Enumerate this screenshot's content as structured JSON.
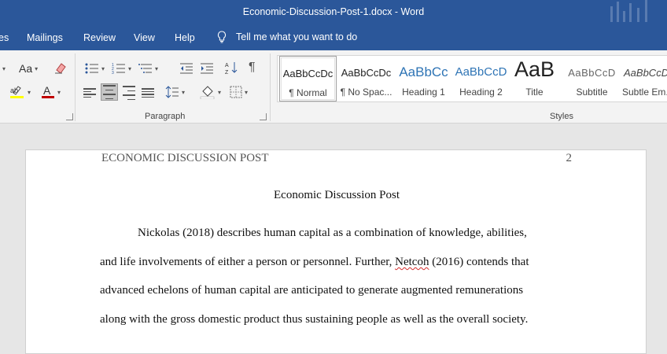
{
  "window": {
    "title": "Economic-Discussion-Post-1.docx  -  Word"
  },
  "tabs": {
    "partial": "es",
    "mailings": "Mailings",
    "review": "Review",
    "view": "View",
    "help": "Help"
  },
  "tell_me": {
    "text": "Tell me what you want to do"
  },
  "ribbon": {
    "font": {
      "change_case": "Aa"
    },
    "paragraph": {
      "label": "Paragraph"
    },
    "styles": {
      "label": "Styles",
      "items": [
        {
          "sample": "AaBbCcDc",
          "name": "¶ Normal",
          "selected": true
        },
        {
          "sample": "AaBbCcDc",
          "name": "¶ No Spac..."
        },
        {
          "sample": "AaBbCc",
          "name": "Heading 1"
        },
        {
          "sample": "AaBbCcD",
          "name": "Heading 2"
        },
        {
          "sample": "AaB",
          "name": "Title"
        },
        {
          "sample": "AaBbCcD",
          "name": "Subtitle"
        },
        {
          "sample": "AaBbCcDc",
          "name": "Subtle Em..."
        }
      ]
    },
    "colors": {
      "highlight": "#ffff00",
      "font_color": "#c00000",
      "accent": "#2b579a"
    }
  },
  "document": {
    "header": "ECONOMIC DISCUSSION POST",
    "page_number": "2",
    "title": "Economic Discussion Post",
    "lines": {
      "l1": "Nickolas (2018) describes human capital as a combination of knowledge, abilities,",
      "l2a": "and life involvements of either a person or personnel. Further, ",
      "l2b": "Netcoh",
      "l2c": " (2016) contends that",
      "l3": "advanced echelons of human capital are anticipated to generate augmented remunerations",
      "l4": "along with the gross domestic product thus sustaining people as well as the overall society."
    }
  }
}
